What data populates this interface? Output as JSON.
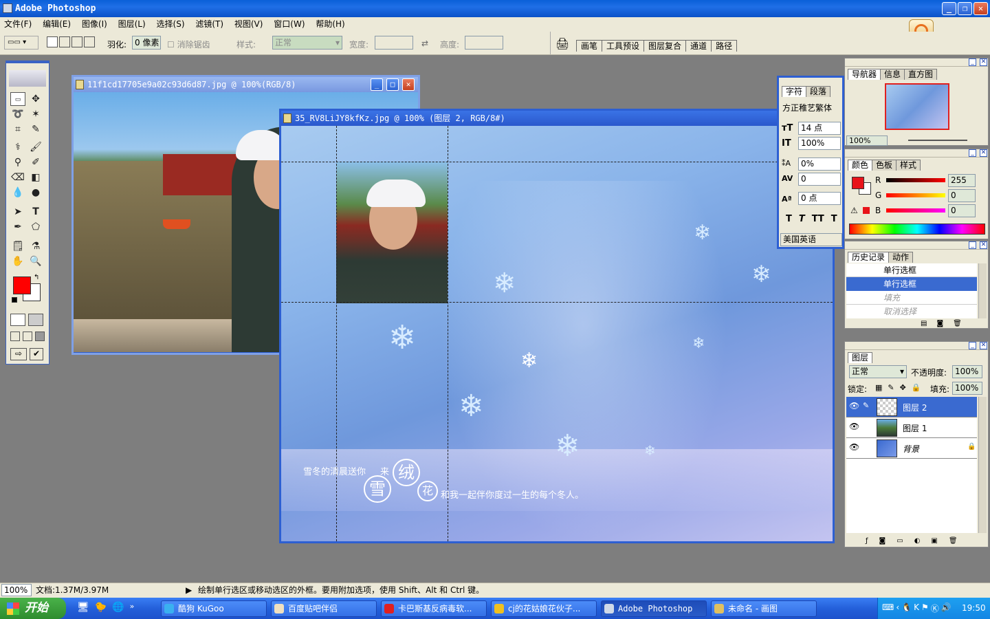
{
  "app": {
    "title": "Adobe Photoshop"
  },
  "menu": [
    "文件(F)",
    "编辑(E)",
    "图像(I)",
    "图层(L)",
    "选择(S)",
    "滤镜(T)",
    "视图(V)",
    "窗口(W)",
    "帮助(H)"
  ],
  "options": {
    "feather_label": "羽化:",
    "feather_value": "0 像素",
    "antialias_label": "消除锯齿",
    "style_label": "样式:",
    "style_value": "正常",
    "width_label": "宽度:",
    "height_label": "高度:",
    "palette_wells": [
      "画笔",
      "工具预设",
      "图层复合",
      "通道",
      "路径"
    ]
  },
  "doc1": {
    "title": "11f1cd17705e9a02c93d6d87.jpg @ 100%(RGB/8)"
  },
  "doc2": {
    "title": "35_RV8LiJY8kfKz.jpg @ 100% (图层 2, RGB/8#)",
    "caption1": "雪冬的清晨送你",
    "caption2": "来",
    "caption3": "和我一起伴你度过一生的每个冬人。",
    "badge_chars": [
      "雪",
      "绒",
      "花"
    ]
  },
  "character_panel": {
    "tabs": [
      "字符",
      "段落"
    ],
    "font": "方正稚艺繁体",
    "size": "14 点",
    "vscale": "100%",
    "tracking_scale": "0%",
    "kerning": "0",
    "baseline": "0 点",
    "style_buttons": [
      "T",
      "T",
      "TT",
      "T"
    ],
    "language": "美国英语"
  },
  "navigator_panel": {
    "tabs": [
      "导航器",
      "信息",
      "直方图"
    ],
    "zoom": "100%"
  },
  "color_panel": {
    "tabs": [
      "颜色",
      "色板",
      "样式"
    ],
    "channels": [
      {
        "label": "R",
        "value": "255"
      },
      {
        "label": "G",
        "value": "0"
      },
      {
        "label": "B",
        "value": "0"
      }
    ],
    "foreground": "#e8141a"
  },
  "history_panel": {
    "tabs": [
      "历史记录",
      "动作"
    ],
    "items": [
      {
        "label": "单行选框",
        "state": "normal"
      },
      {
        "label": "单行选框",
        "state": "selected"
      },
      {
        "label": "填充",
        "state": "undone"
      },
      {
        "label": "取消选择",
        "state": "undone"
      }
    ]
  },
  "layers_panel": {
    "tabs": [
      "图层"
    ],
    "blend_mode": "正常",
    "opacity_label": "不透明度:",
    "opacity_value": "100%",
    "lock_label": "锁定:",
    "fill_label": "填充:",
    "fill_value": "100%",
    "layers": [
      {
        "name": "图层 2",
        "selected": true
      },
      {
        "name": "图层 1",
        "selected": false
      },
      {
        "name": "背景",
        "selected": false,
        "locked": true
      }
    ]
  },
  "status": {
    "zoom": "100%",
    "doc_size": "文档:1.37M/3.97M",
    "hint": "绘制单行选区或移动选区的外框。要用附加选项，使用 Shift、Alt 和 Ctrl 键。"
  },
  "taskbar": {
    "start_label": "开始",
    "tasks": [
      {
        "label": "酷狗 KuGoo",
        "active": false
      },
      {
        "label": "百度贴吧伴侣",
        "active": false
      },
      {
        "label": "卡巴斯基反病毒软...",
        "active": false
      },
      {
        "label": "cj的花姑娘花伙子...",
        "active": false
      },
      {
        "label": "Adobe Photoshop",
        "active": true
      },
      {
        "label": "未命名 - 画图",
        "active": false
      }
    ],
    "clock": "19:50"
  }
}
